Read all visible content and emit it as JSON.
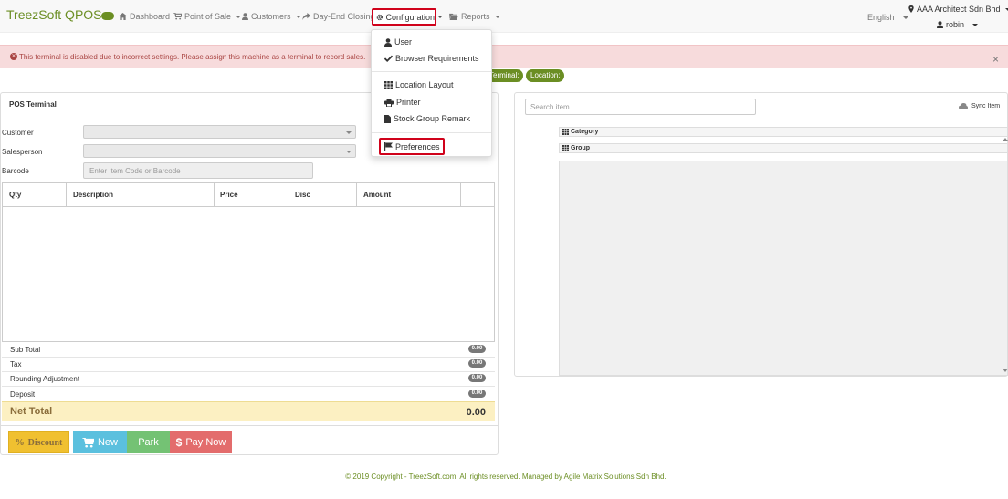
{
  "navbar": {
    "brand": "TreezSoft QPOS",
    "brand_badge": "",
    "items": {
      "dashboard": "Dashboard",
      "point_of_sale": "Point of Sale",
      "customers": "Customers",
      "day_end_closing": "Day-End Closing",
      "configuration": "Configuration",
      "reports": "Reports"
    },
    "language": "English",
    "company": "AAA Architect Sdn Bhd",
    "user": "robin"
  },
  "alert": {
    "message": "This terminal is disabled due to incorrect settings. Please assign this machine as a terminal to record sales.",
    "close": "×"
  },
  "tags": {
    "terminal": "Terminal:",
    "location": "Location:"
  },
  "config_menu": {
    "user": "User",
    "browser_requirements": "Browser Requirements",
    "location_layout": "Location Layout",
    "printer": "Printer",
    "stock_group_remark": "Stock Group Remark",
    "preferences": "Preferences"
  },
  "pos": {
    "title": "POS Terminal",
    "customer_label": "Customer",
    "salesperson_label": "Salesperson",
    "barcode_label": "Barcode",
    "barcode_placeholder": "Enter Item Code or Barcode",
    "columns": {
      "qty": "Qty",
      "description": "Description",
      "price": "Price",
      "disc": "Disc",
      "amount": "Amount"
    },
    "summary": {
      "sub_total": {
        "label": "Sub Total",
        "value": "0.00"
      },
      "tax": {
        "label": "Tax",
        "value": "0.00"
      },
      "rounding": {
        "label": "Rounding Adjustment",
        "value": "0.00"
      },
      "deposit": {
        "label": "Deposit",
        "value": "0.00"
      }
    },
    "net_total": {
      "label": "Net Total",
      "value": "0.00"
    },
    "buttons": {
      "discount": "Discount",
      "new": "New",
      "park": "Park",
      "pay_now": "Pay Now"
    }
  },
  "items_panel": {
    "search_placeholder": "Search item....",
    "sync_label": "Sync Item",
    "category": "Category",
    "group": "Group"
  },
  "footer": {
    "copyright": "© 2019 Copyright - TreezSoft.com. All rights reserved. Managed by Agile Matrix Solutions Sdn Bhd."
  },
  "colors": {
    "brand": "#6b8e23",
    "highlight_border": "#d0021b",
    "alert_bg": "#f7dbdc",
    "alert_text": "#a94442",
    "net_total_bg": "#fcf0c2"
  }
}
